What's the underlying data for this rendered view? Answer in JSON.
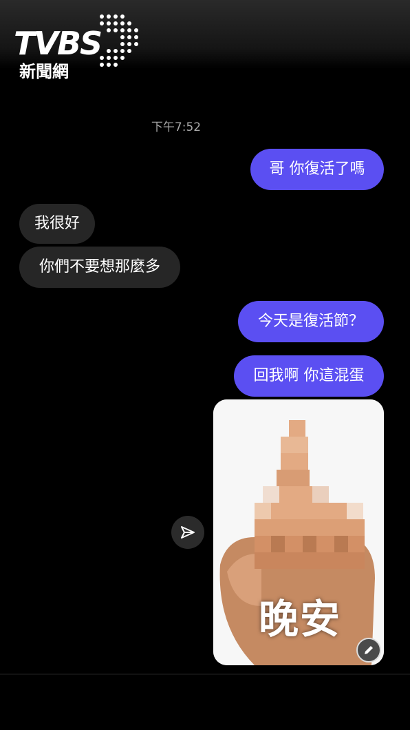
{
  "watermark": {
    "brand": "TVBS",
    "sub": "新聞網"
  },
  "chat": {
    "timestamp": "下午7:52",
    "messages": [
      {
        "text": "哥 你復活了嗎"
      },
      {
        "text": "我很好"
      },
      {
        "text": "你們不要想那麼多"
      },
      {
        "text": "今天是復活節？"
      },
      {
        "text": "回我啊 你這混蛋"
      }
    ],
    "sticker_caption": "晚安"
  },
  "icons": {
    "share": "send-arrow-icon",
    "edit": "pencil-icon"
  },
  "colors": {
    "sent_bubble": "#5b4ff2",
    "received_bubble": "#262626",
    "background": "#000000"
  }
}
